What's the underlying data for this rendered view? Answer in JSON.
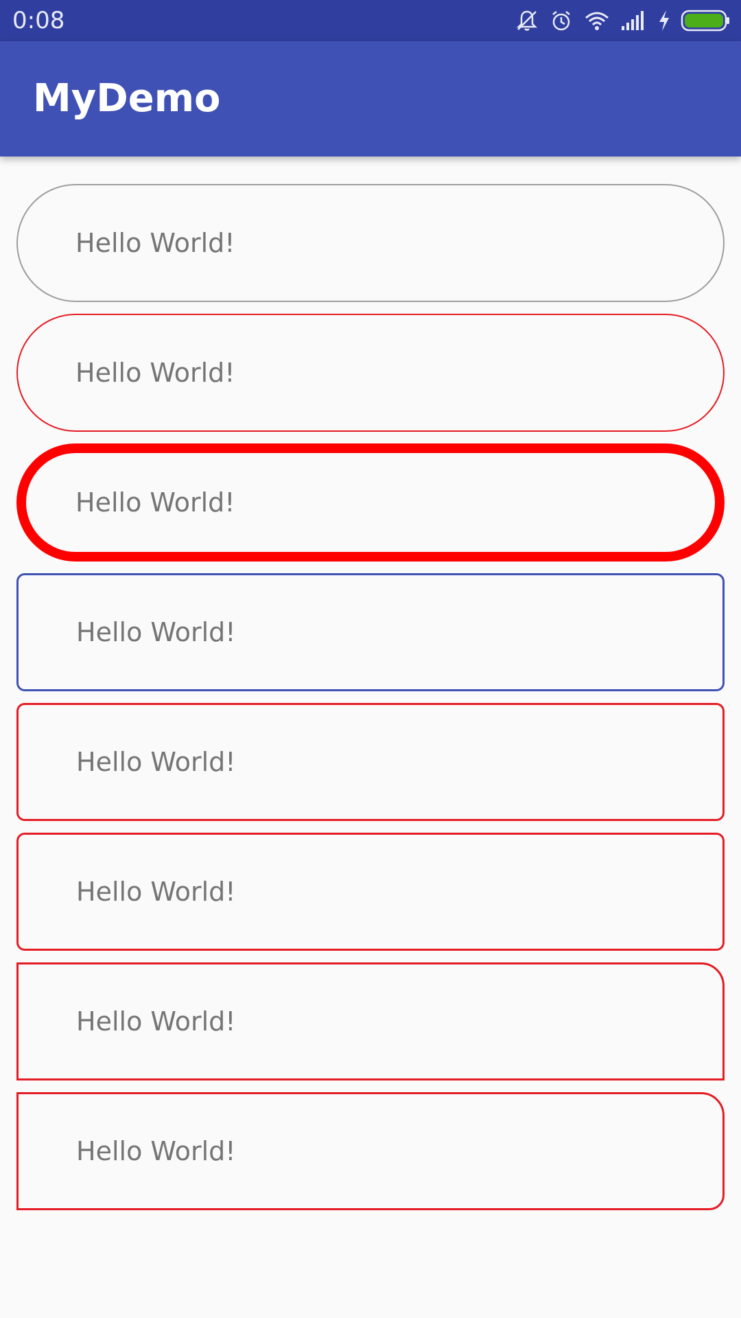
{
  "status_bar": {
    "time": "0:08",
    "icons": [
      "muted-bell-icon",
      "alarm-icon",
      "wifi-icon",
      "signal-icon",
      "charging-icon",
      "battery-icon"
    ],
    "battery_color": "#4caf1a"
  },
  "app_bar": {
    "title": "MyDemo",
    "color": "#3f51b5"
  },
  "text_views": [
    {
      "text": "Hello World!",
      "border_color": "#9e9e9e"
    },
    {
      "text": "Hello World!",
      "border_color": "#e51c23"
    },
    {
      "text": "Hello World!",
      "border_color": "#ff0000"
    },
    {
      "text": "Hello World!",
      "border_color": "#3f51b5"
    },
    {
      "text": "Hello World!",
      "border_color": "#e51c23"
    },
    {
      "text": "Hello World!",
      "border_color": "#e51c23"
    },
    {
      "text": "Hello World!",
      "border_color": "#e51c23"
    },
    {
      "text": "Hello World!",
      "border_color": "#e51c23"
    }
  ]
}
